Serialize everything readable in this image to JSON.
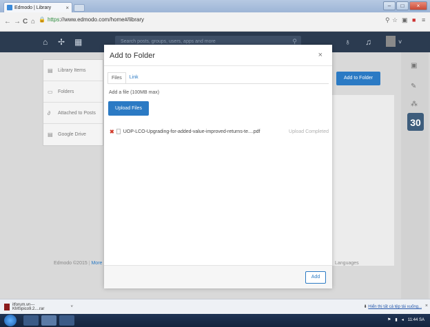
{
  "browser": {
    "tab_title": "Edmodo | Library",
    "tab_close": "×",
    "url_scheme": "https",
    "url_rest": "://www.edmodo.com/home#/library",
    "back_icon": "arrow-left-icon",
    "forward_icon": "arrow-right-icon",
    "reload_icon": "reload-icon",
    "home_icon": "home-icon"
  },
  "topnav": {
    "search_placeholder": "Search posts, groups, users, apps and more"
  },
  "sidebar": {
    "items": [
      {
        "label": "Library Items",
        "icon": "library-icon"
      },
      {
        "label": "Folders",
        "icon": "folder-icon"
      },
      {
        "label": "Attached to Posts",
        "icon": "paperclip-icon"
      },
      {
        "label": "Google Drive",
        "icon": "drive-icon"
      }
    ]
  },
  "page": {
    "add_to_folder_label": "Add to Folder",
    "footer_left": "Edmodo ©2015",
    "footer_left_link": "More",
    "footer_right": "Languages",
    "calendar_day": "30"
  },
  "modal": {
    "title": "Add to Folder",
    "close": "×",
    "tabs": [
      "Files",
      "Link"
    ],
    "hint": "Add a file (100MB max)",
    "upload_label": "Upload Files",
    "file": {
      "remove_glyph": "✖",
      "name": "UOP-LCO-Upgrading-for-added-value-improved-returns-te....pdf",
      "status": "Upload Completed"
    },
    "add_label": "Add"
  },
  "download_bar": {
    "file_label": "itforum.vn---KMSpico9.2....rar",
    "arrow": "˅",
    "show_all": "Hiển thị tất cả tệp tải xuống...",
    "close": "×"
  },
  "taskbar": {
    "time": "11:44 SA"
  }
}
